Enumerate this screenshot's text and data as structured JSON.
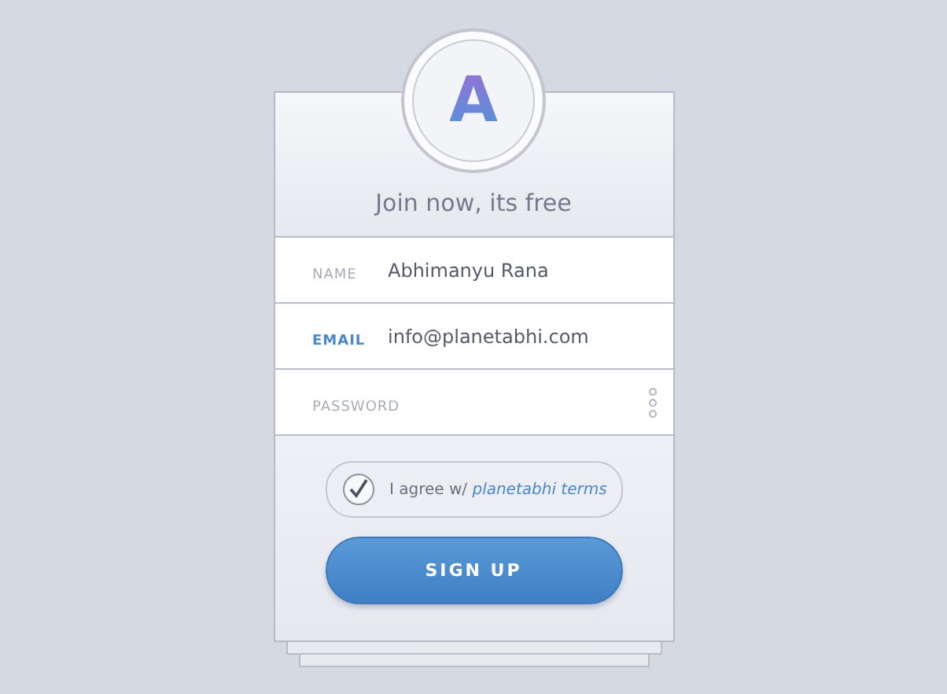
{
  "logo": {
    "letter": "A"
  },
  "title": "Join now, its free",
  "fields": [
    {
      "label": "NAME",
      "value": "Abhimanyu Rana",
      "focused": false,
      "kind": "text"
    },
    {
      "label": "EMAIL",
      "value": "info@planetabhi.com",
      "focused": true,
      "kind": "text"
    },
    {
      "label": "PASSWORD",
      "focused": false,
      "kind": "password"
    }
  ],
  "agree": {
    "text": "I agree w/",
    "link": "planetabhi terms",
    "checked": true
  },
  "submit": "SIGN UP"
}
